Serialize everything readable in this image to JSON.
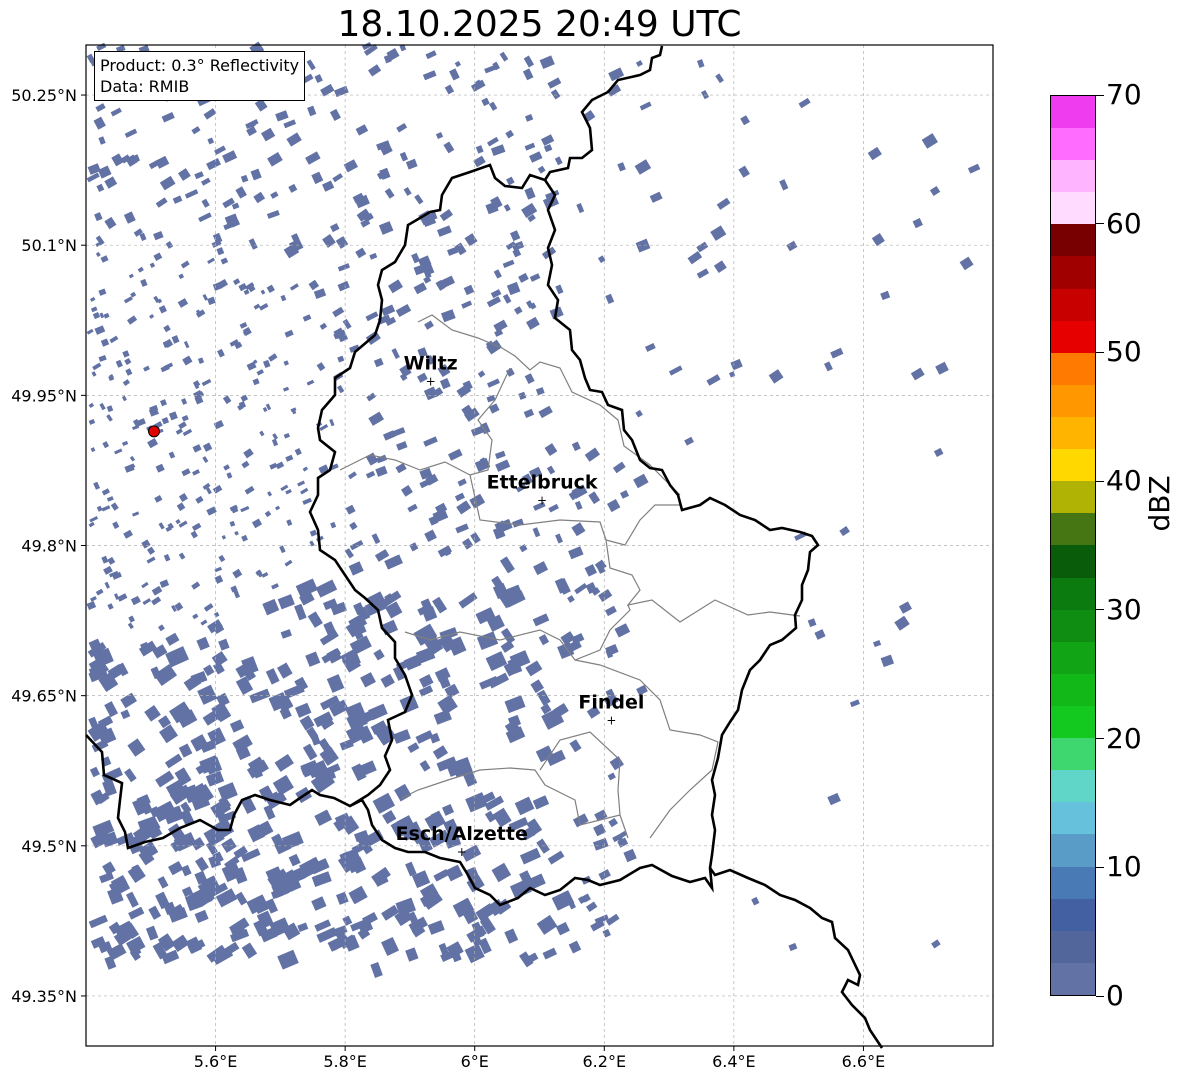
{
  "title": "18.10.2025 20:49 UTC",
  "info": {
    "product": "Product: 0.3° Reflectivity",
    "data": "Data: RMIB"
  },
  "map": {
    "lon_range": [
      5.4,
      6.8
    ],
    "lat_range": [
      49.3,
      50.3
    ],
    "lat_ticks": [
      {
        "value": 50.25,
        "label": "50.25°N"
      },
      {
        "value": 50.1,
        "label": "50.1°N"
      },
      {
        "value": 49.95,
        "label": "49.95°N"
      },
      {
        "value": 49.8,
        "label": "49.8°N"
      },
      {
        "value": 49.65,
        "label": "49.65°N"
      },
      {
        "value": 49.5,
        "label": "49.5°N"
      },
      {
        "value": 49.35,
        "label": "49.35°N"
      }
    ],
    "lon_ticks": [
      {
        "value": 5.6,
        "label": "5.6°E"
      },
      {
        "value": 5.8,
        "label": "5.8°E"
      },
      {
        "value": 6.0,
        "label": "6°E"
      },
      {
        "value": 6.2,
        "label": "6.2°E"
      },
      {
        "value": 6.4,
        "label": "6.4°E"
      },
      {
        "value": 6.6,
        "label": "6.6°E"
      }
    ],
    "cities": [
      {
        "name": "Wiltz",
        "lon": 5.932,
        "lat": 49.966
      },
      {
        "name": "Ettelbruck",
        "lon": 6.104,
        "lat": 49.847
      },
      {
        "name": "Findel",
        "lon": 6.211,
        "lat": 49.627
      },
      {
        "name": "Esch/Alzette",
        "lon": 5.98,
        "lat": 49.496
      }
    ],
    "radar_site": {
      "lon": 5.505,
      "lat": 49.914
    },
    "echo_color": "#6272a4",
    "border_color": "#000000",
    "canton_color": "#808080",
    "grid": true
  },
  "colorbar": {
    "label": "dBZ",
    "min": 0,
    "max": 70,
    "step": 2.5,
    "ticks": [
      {
        "value": 0,
        "label": "0"
      },
      {
        "value": 10,
        "label": "10"
      },
      {
        "value": 20,
        "label": "20"
      },
      {
        "value": 30,
        "label": "30"
      },
      {
        "value": 40,
        "label": "40"
      },
      {
        "value": 50,
        "label": "50"
      },
      {
        "value": 60,
        "label": "60"
      },
      {
        "value": 70,
        "label": "70"
      }
    ],
    "colors": [
      "#6272a4",
      "#52669c",
      "#4360a2",
      "#4a7ab6",
      "#5a9cc8",
      "#66c1dc",
      "#5fd6c8",
      "#3ed66e",
      "#13c81e",
      "#12b818",
      "#11a415",
      "#0f8c12",
      "#0b7a0f",
      "#085c0a",
      "#467514",
      "#b0b204",
      "#ffd800",
      "#ffb400",
      "#ff9800",
      "#ff7a00",
      "#e60000",
      "#c80000",
      "#a00000",
      "#780000",
      "#ffdcff",
      "#ffb4ff",
      "#ff6cff",
      "#ee3cee"
    ]
  }
}
